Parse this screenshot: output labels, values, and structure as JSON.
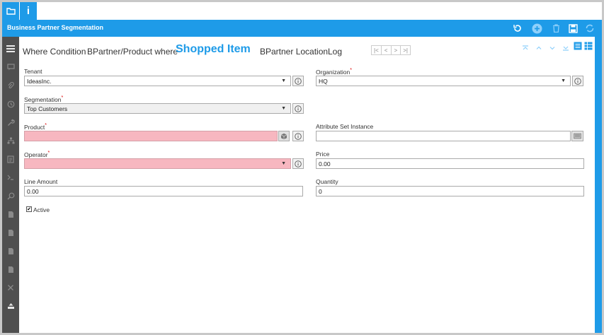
{
  "window": {
    "title": "Business Partner Segmentation"
  },
  "top_tabs": [
    {
      "icon": "folder-icon"
    },
    {
      "icon": "info-icon"
    }
  ],
  "toolbar": {
    "icons": [
      "refresh-icon",
      "new-record-icon",
      "delete-icon",
      "save-icon",
      "sync-icon"
    ]
  },
  "tabs": {
    "where_condition": "Where Condition",
    "bpartner_product_where": "BPartner/Product where",
    "shopped_item": "Shopped Item",
    "bpartner_location": "BPartner Location",
    "log": "Log"
  },
  "record_nav": {
    "first": "|<",
    "prev": "<",
    "next": ">",
    "last": ">|"
  },
  "form": {
    "tenant": {
      "label": "Tenant",
      "value": "IdeasInc."
    },
    "organization": {
      "label": "Organization",
      "required_mark": "*",
      "value": "HQ"
    },
    "segmentation": {
      "label": "Segmentation",
      "required_mark": "*",
      "value": "Top Customers"
    },
    "product": {
      "label": "Product",
      "required_mark": "*",
      "value": ""
    },
    "attribute_set_instance": {
      "label": "Attribute Set Instance",
      "value": ""
    },
    "operator": {
      "label": "Operator",
      "required_mark": "*",
      "value": ""
    },
    "price": {
      "label": "Price",
      "value": "0.00"
    },
    "line_amount": {
      "label": "Line Amount",
      "value": "0.00"
    },
    "quantity": {
      "label": "Quantity",
      "value": "0"
    },
    "active": {
      "label": "Active",
      "checked": true
    }
  },
  "colors": {
    "accent": "#1e9be8",
    "required_bg": "#f7b7c0",
    "rail": "#4f4f4f"
  }
}
